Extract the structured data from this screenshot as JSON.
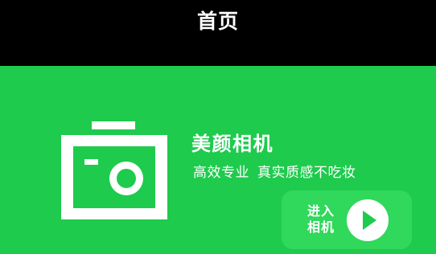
{
  "colors": {
    "background": "#1ecb4d",
    "top_bar": "#000000",
    "text": "#ffffff",
    "button": "#30d85b",
    "play_icon": "#1ecb4d"
  },
  "header": {
    "title": "首页"
  },
  "hero": {
    "icon": "camera-icon",
    "app_name": "美颜相机",
    "tagline": {
      "part1": "高效专业",
      "part2": "真实质感不吃妆"
    },
    "enter_button": {
      "line1": "进入",
      "line2": "相机",
      "icon": "play-icon"
    }
  }
}
